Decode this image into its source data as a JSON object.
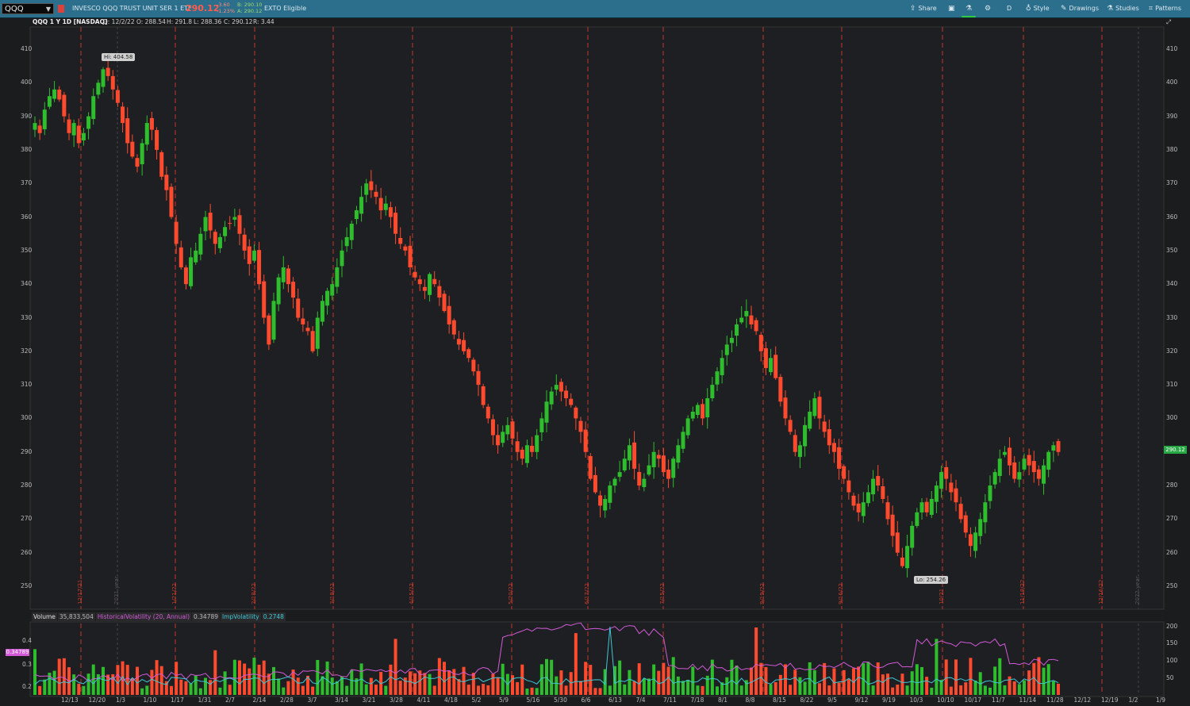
{
  "topbar": {
    "symbol": "QQQ",
    "description": "INVESCO QQQ TRUST UNIT SER 1 ETF",
    "last": "290.12",
    "change": "-3.60",
    "change_pct": "-1.23%",
    "bid": "B: 290.10",
    "ask": "A: 290.12",
    "ext_label": "EXTO Eligible",
    "buttons": {
      "share": "Share",
      "period": "D",
      "style": "Style",
      "drawings": "Drawings",
      "studies": "Studies",
      "patterns": "Patterns"
    }
  },
  "header": {
    "title": "QQQ 1 Y 1D [NASDAQ]",
    "date": "D: 12/2/22",
    "open": "O: 288.54",
    "high": "H: 291.8",
    "low": "L: 288.36",
    "close": "C: 290.12",
    "range": "R: 3.44"
  },
  "price_axis": [
    "410",
    "400",
    "390",
    "380",
    "370",
    "360",
    "350",
    "340",
    "330",
    "320",
    "310",
    "300",
    "290",
    "280",
    "270",
    "260",
    "250"
  ],
  "last_price_tag": "290.12",
  "hi_label": "Hi: 404.58",
  "lo_label": "Lo: 254.26",
  "indicators": {
    "volume_label": "Volume",
    "volume_value": "35,833,504",
    "hv_label": "HistoricalVolatility (20, Annual)",
    "hv_value": "0.34789",
    "iv_label": "ImpVolatility",
    "iv_value": "0.2748",
    "hv_tag": "0.34789",
    "left_axis": [
      "0.4",
      "0.3",
      "0.2"
    ],
    "right_axis": [
      "200",
      "150",
      "100",
      "50"
    ]
  },
  "x_axis": [
    "12/13",
    "12/20",
    "1/3",
    "1/10",
    "1/17",
    "1/31",
    "2/7",
    "2/14",
    "2/28",
    "3/7",
    "3/14",
    "3/21",
    "3/28",
    "4/11",
    "4/18",
    "5/2",
    "5/9",
    "5/16",
    "5/30",
    "6/6",
    "6/13",
    "7/4",
    "7/11",
    "7/18",
    "8/1",
    "8/8",
    "8/15",
    "8/22",
    "9/5",
    "9/12",
    "9/19",
    "10/3",
    "10/10",
    "10/17",
    "11/7",
    "11/14",
    "11/28",
    "12/12",
    "12/19",
    "1/2",
    "1/9"
  ],
  "expiration_labels": [
    "12/17/21",
    "2021 year",
    "1/21/22",
    "2/18/22",
    "3/18/22",
    "4/15/22",
    "5/20/22",
    "6/17/22",
    "7/15/22",
    "8/19/22",
    "9/16/22",
    "10/21",
    "11/18/22",
    "12/16/22",
    "2022 year"
  ],
  "colors": {
    "up": "#2dbd2d",
    "down": "#ff4a2d",
    "hv_line": "#d25ad8",
    "iv_line": "#3fc8d6",
    "expiry_line": "#c0392b"
  },
  "chart_data": {
    "type": "candlestick",
    "title": "QQQ 1 Y 1D [NASDAQ]",
    "ylim": [
      245,
      415
    ],
    "close_series": [
      388,
      385,
      392,
      396,
      398,
      395,
      390,
      385,
      388,
      382,
      385,
      390,
      396,
      400,
      404,
      402,
      398,
      394,
      388,
      382,
      378,
      375,
      382,
      388,
      386,
      380,
      372,
      368,
      360,
      352,
      345,
      340,
      348,
      350,
      355,
      360,
      356,
      352,
      354,
      357,
      358,
      360,
      355,
      350,
      346,
      350,
      340,
      330,
      322,
      335,
      342,
      345,
      340,
      336,
      330,
      328,
      326,
      320,
      330,
      335,
      338,
      340,
      345,
      350,
      354,
      358,
      362,
      366,
      370,
      368,
      366,
      362,
      364,
      360,
      355,
      352,
      350,
      345,
      342,
      340,
      338,
      343,
      340,
      336,
      332,
      328,
      325,
      322,
      320,
      318,
      314,
      310,
      304,
      300,
      295,
      292,
      296,
      298,
      294,
      290,
      288,
      292,
      290,
      295,
      300,
      305,
      308,
      310,
      308,
      306,
      304,
      300,
      296,
      290,
      282,
      278,
      274,
      276,
      280,
      282,
      284,
      288,
      292,
      285,
      280,
      282,
      286,
      290,
      288,
      284,
      282,
      288,
      292,
      296,
      300,
      302,
      304,
      300,
      306,
      310,
      314,
      318,
      322,
      324,
      328,
      330,
      332,
      328,
      326,
      320,
      315,
      318,
      312,
      305,
      300,
      296,
      290,
      292,
      298,
      302,
      306,
      300,
      296,
      292,
      290,
      285,
      282,
      278,
      274,
      272,
      275,
      278,
      282,
      280,
      276,
      270,
      265,
      260,
      256,
      262,
      268,
      272,
      275,
      272,
      276,
      280,
      284,
      282,
      278,
      275,
      270,
      266,
      262,
      266,
      270,
      275,
      280,
      284,
      288,
      290,
      286,
      282,
      284,
      288,
      286,
      284,
      282,
      286,
      290,
      292,
      290
    ]
  }
}
